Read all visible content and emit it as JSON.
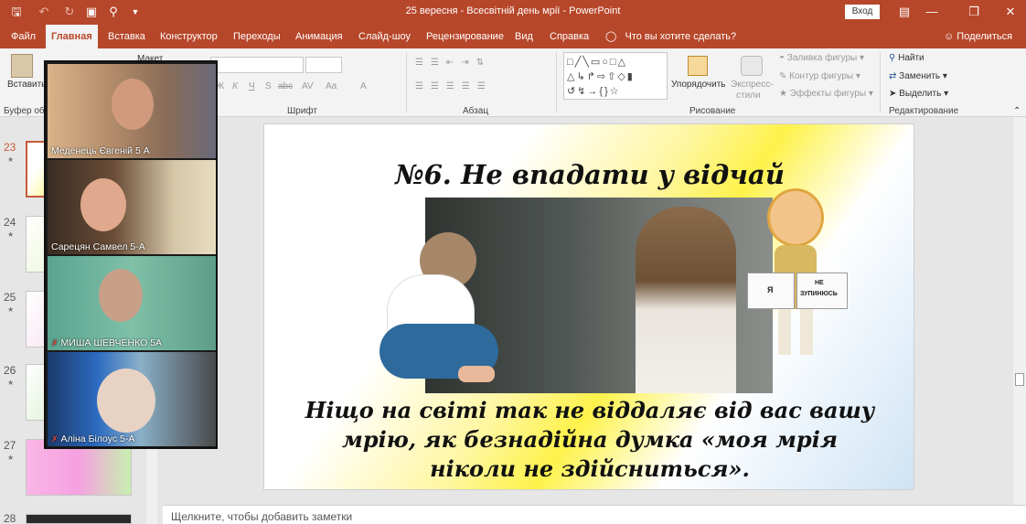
{
  "titlebar": {
    "doc_title": "25 вересня - Всесвітній день мрії  -  PowerPoint",
    "login_label": "Вход"
  },
  "menu": {
    "tabs": [
      "Файл",
      "Главная",
      "Вставка",
      "Конструктор",
      "Переходы",
      "Анимация",
      "Слайд-шоу",
      "Рецензирование",
      "Вид",
      "Справка"
    ],
    "active_tab": "Главная",
    "tell_me": "Что вы хотите сделать?",
    "share": "Поделиться"
  },
  "ribbon": {
    "paste_label": "Вставить",
    "clipboard_label": "Буфер обм",
    "layout_label": "Макет",
    "font_group": "Шрифт",
    "paragraph_group": "Абзац",
    "drawing_group": "Рисование",
    "editing_group": "Редактирование",
    "arrange_label": "Упорядочить",
    "express_styles_label_1": "Экспресс-",
    "express_styles_label_2": "стили",
    "shape_fill": "Заливка фигуры",
    "shape_outline": "Контур фигуры",
    "shape_effects": "Эффекты фигуры",
    "find": "Найти",
    "replace": "Заменить",
    "select": "Выделить",
    "font_buttons": [
      "Ж",
      "К",
      "Ч",
      "S",
      "abc",
      "AV",
      "Aa",
      "A"
    ]
  },
  "thumbnails": [
    {
      "num": "23",
      "selected": true
    },
    {
      "num": "24",
      "selected": false
    },
    {
      "num": "25",
      "selected": false
    },
    {
      "num": "26",
      "selected": false
    },
    {
      "num": "27",
      "selected": false
    },
    {
      "num": "28",
      "selected": false
    }
  ],
  "slide": {
    "title": "№6. Не впадати у відчай",
    "body_line1": "Ніщо на світі так не віддаляє від вас вашу",
    "body_line2": "мрію, як безнадійна думка «моя мрія",
    "body_line3": "ніколи не здійсниться».",
    "sign_left": "Я",
    "sign_right_1": "НЕ",
    "sign_right_2": "ЗУПИНЮСЬ"
  },
  "notes": {
    "placeholder": "Щелкните, чтобы добавить заметки"
  },
  "video_call": {
    "participants": [
      {
        "name": "Меденець Євгеній 5 А",
        "muted": false
      },
      {
        "name": "Сарецян Самвел 5-А",
        "muted": false
      },
      {
        "name": "МИША ШЕВЧЕНКО 5А",
        "muted": true
      },
      {
        "name": "Аліна Білоус 5-А",
        "muted": true
      }
    ]
  },
  "colors": {
    "accent": "#b7472a",
    "ribbon_bg": "#f3f3f3",
    "workspace_bg": "#e6e6e6"
  }
}
